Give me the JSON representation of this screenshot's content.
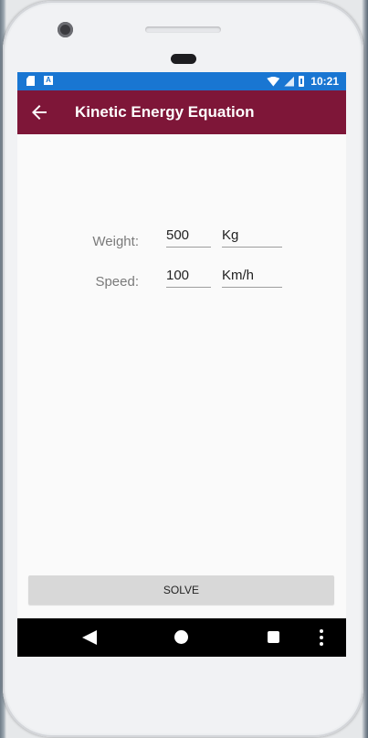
{
  "status_bar": {
    "time": "10:21",
    "left_icons": [
      "sd-card-icon",
      "a-notification-icon"
    ],
    "right_icons": [
      "wifi-icon",
      "signal-icon",
      "battery-charging-icon"
    ]
  },
  "app_bar": {
    "title": "Kinetic Energy Equation",
    "background": "#7e1638",
    "back_icon": "arrow-back-icon"
  },
  "form": {
    "weight": {
      "label": "Weight:",
      "value": "500",
      "unit": "Kg"
    },
    "speed": {
      "label": "Speed:",
      "value": "100",
      "unit": "Km/h"
    }
  },
  "solve_button": {
    "label": "SOLVE"
  },
  "nav_bar": {
    "icons": [
      "back-triangle-icon",
      "home-circle-icon",
      "recents-square-icon",
      "overflow-menu-icon"
    ]
  },
  "colors": {
    "status_bar": "#1976d2",
    "accent": "#7e1638",
    "button": "#d8d8d8"
  }
}
